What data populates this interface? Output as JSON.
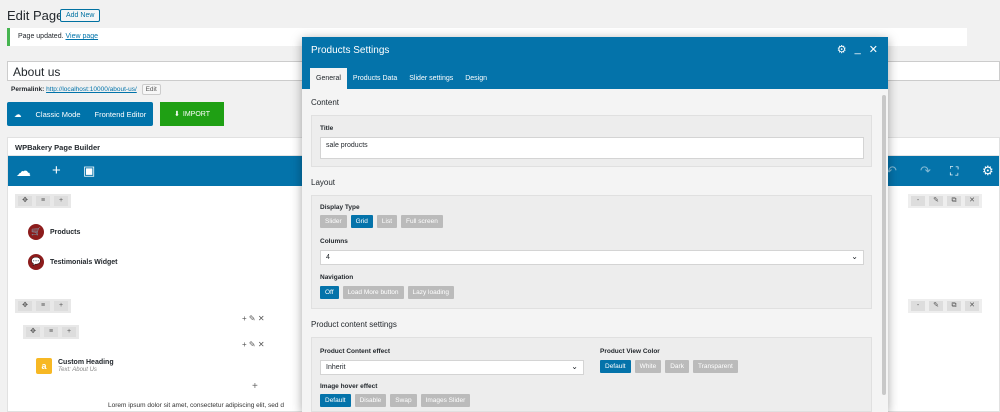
{
  "page": {
    "title": "Edit Page",
    "add_new": "Add New",
    "notice_text": "Page updated.",
    "notice_link": "View page",
    "post_title": "About us",
    "permalink_label": "Permalink:",
    "permalink_url": "http://localhost:10000/about-us/",
    "permalink_edit": "Edit",
    "mode_classic": "Classic Mode",
    "mode_frontend": "Frontend Editor",
    "import_label": "IMPORT"
  },
  "builder": {
    "header": "WPBakery Page Builder",
    "elements": {
      "products": "Products",
      "testimonials": "Testimonials Widget",
      "custom_heading": "Custom Heading",
      "custom_heading_sub": "Text: About Us",
      "lorem": "Lorem ipsum dolor sit amet, consectetur adipiscing elit, sed d"
    }
  },
  "modal": {
    "title": "Products Settings",
    "tabs": [
      "General",
      "Products Data",
      "Slider settings",
      "Design"
    ],
    "active_tab": "General",
    "content_section": "Content",
    "title_label": "Title",
    "title_value": "sale products",
    "layout_section": "Layout",
    "display_type_label": "Display Type",
    "display_type_options": [
      "Slider",
      "Grid",
      "List",
      "Full screen"
    ],
    "display_type_selected": "Grid",
    "columns_label": "Columns",
    "columns_value": "4",
    "navigation_label": "Navigation",
    "navigation_options": [
      "Off",
      "Load More button",
      "Lazy loading"
    ],
    "navigation_selected": "Off",
    "product_content_section": "Product content settings",
    "content_effect_label": "Product Content effect",
    "content_effect_value": "Inherit",
    "view_color_label": "Product View Color",
    "view_color_options": [
      "Default",
      "White",
      "Dark",
      "Transparent"
    ],
    "view_color_selected": "Default",
    "hover_label": "Image hover effect",
    "hover_options": [
      "Default",
      "Disable",
      "Swap",
      "Images Slider"
    ],
    "hover_selected": "Default"
  },
  "colors": {
    "accent": "#0473aa",
    "import": "#1fa014",
    "notice": "#46b450"
  }
}
